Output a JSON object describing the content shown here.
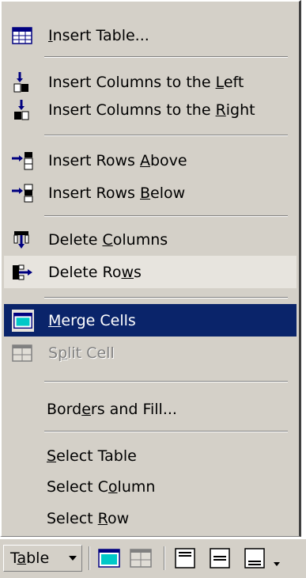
{
  "menu": {
    "items": [
      {
        "id": "insert-table",
        "pre": "",
        "acc": "I",
        "post": "nsert Table...",
        "icon": "insert-table-icon"
      },
      {
        "id": "insert-columns-left",
        "pre": "Insert Columns to the ",
        "acc": "L",
        "post": "eft",
        "icon": "insert-columns-left-icon"
      },
      {
        "id": "insert-columns-right",
        "pre": "Insert Columns to the ",
        "acc": "R",
        "post": "ight",
        "icon": "insert-columns-right-icon"
      },
      {
        "id": "insert-rows-above",
        "pre": "Insert Rows ",
        "acc": "A",
        "post": "bove",
        "icon": "insert-rows-above-icon"
      },
      {
        "id": "insert-rows-below",
        "pre": "Insert Rows ",
        "acc": "B",
        "post": "elow",
        "icon": "insert-rows-below-icon"
      },
      {
        "id": "delete-columns",
        "pre": "Delete ",
        "acc": "C",
        "post": "olumns",
        "icon": "delete-columns-icon"
      },
      {
        "id": "delete-rows",
        "pre": "Delete Ro",
        "acc": "w",
        "post": "s",
        "icon": "delete-rows-icon",
        "state": "hover"
      },
      {
        "id": "merge-cells",
        "pre": "",
        "acc": "M",
        "post": "erge Cells",
        "icon": "merge-cells-icon",
        "state": "selected"
      },
      {
        "id": "split-cell",
        "pre": "S",
        "acc": "p",
        "post": "lit Cell",
        "icon": "split-cell-icon",
        "state": "disabled"
      },
      {
        "id": "borders-and-fill",
        "pre": "Bord",
        "acc": "e",
        "post": "rs and Fill...",
        "icon": ""
      },
      {
        "id": "select-table",
        "pre": "",
        "acc": "S",
        "post": "elect Table",
        "icon": ""
      },
      {
        "id": "select-column",
        "pre": "Select C",
        "acc": "o",
        "post": "lumn",
        "icon": ""
      },
      {
        "id": "select-row",
        "pre": "Select ",
        "acc": "R",
        "post": "ow",
        "icon": ""
      }
    ]
  },
  "toolbar": {
    "table_pre": "T",
    "table_acc": "a",
    "table_post": "ble",
    "buttons": [
      "merge-cells-icon",
      "split-cell-icon",
      "align-top-icon",
      "align-center-icon",
      "align-bottom-icon"
    ],
    "more": "chevron-down-icon"
  },
  "colors": {
    "menu_bg": "#d4d0c8",
    "highlight": "#0a246a",
    "hover": "#e7e4de",
    "disabled": "#808080"
  }
}
